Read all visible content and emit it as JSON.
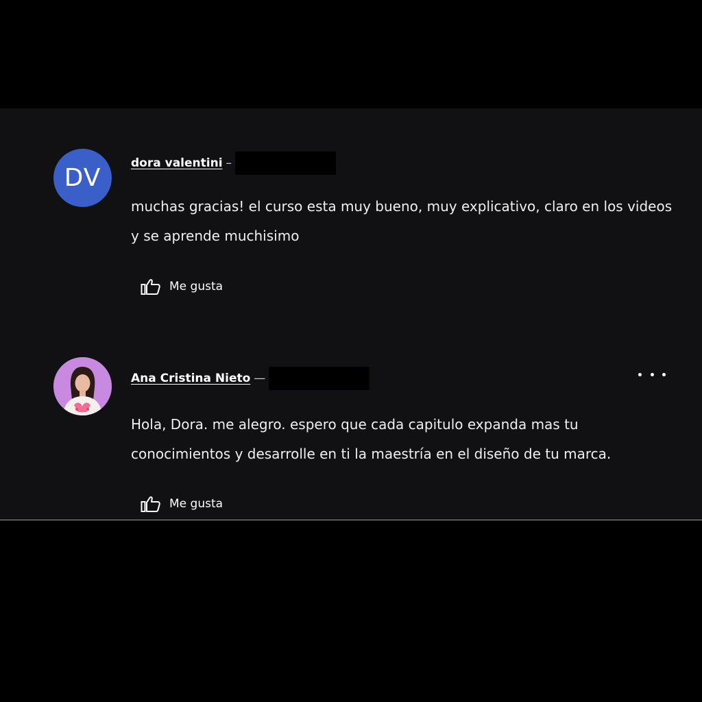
{
  "comments": [
    {
      "avatar": {
        "type": "initials",
        "text": "DV",
        "color": "#3a5fc9"
      },
      "author": "dora valentini",
      "separator": "–",
      "text": "muchas gracias! el curso esta muy bueno, muy explicativo, claro en los videos y se aprende muchisimo",
      "like_label": "Me gusta"
    },
    {
      "avatar": {
        "type": "photo",
        "color": "#c78ae0"
      },
      "author": "Ana Cristina Nieto",
      "separator": "—",
      "text": "Hola, Dora. me alegro. espero que cada capitulo expanda mas tu conocimientos y desarrolle en ti la maestría en el diseño de tu marca.",
      "like_label": "Me gusta",
      "more_icon": "more-horizontal-icon"
    }
  ]
}
